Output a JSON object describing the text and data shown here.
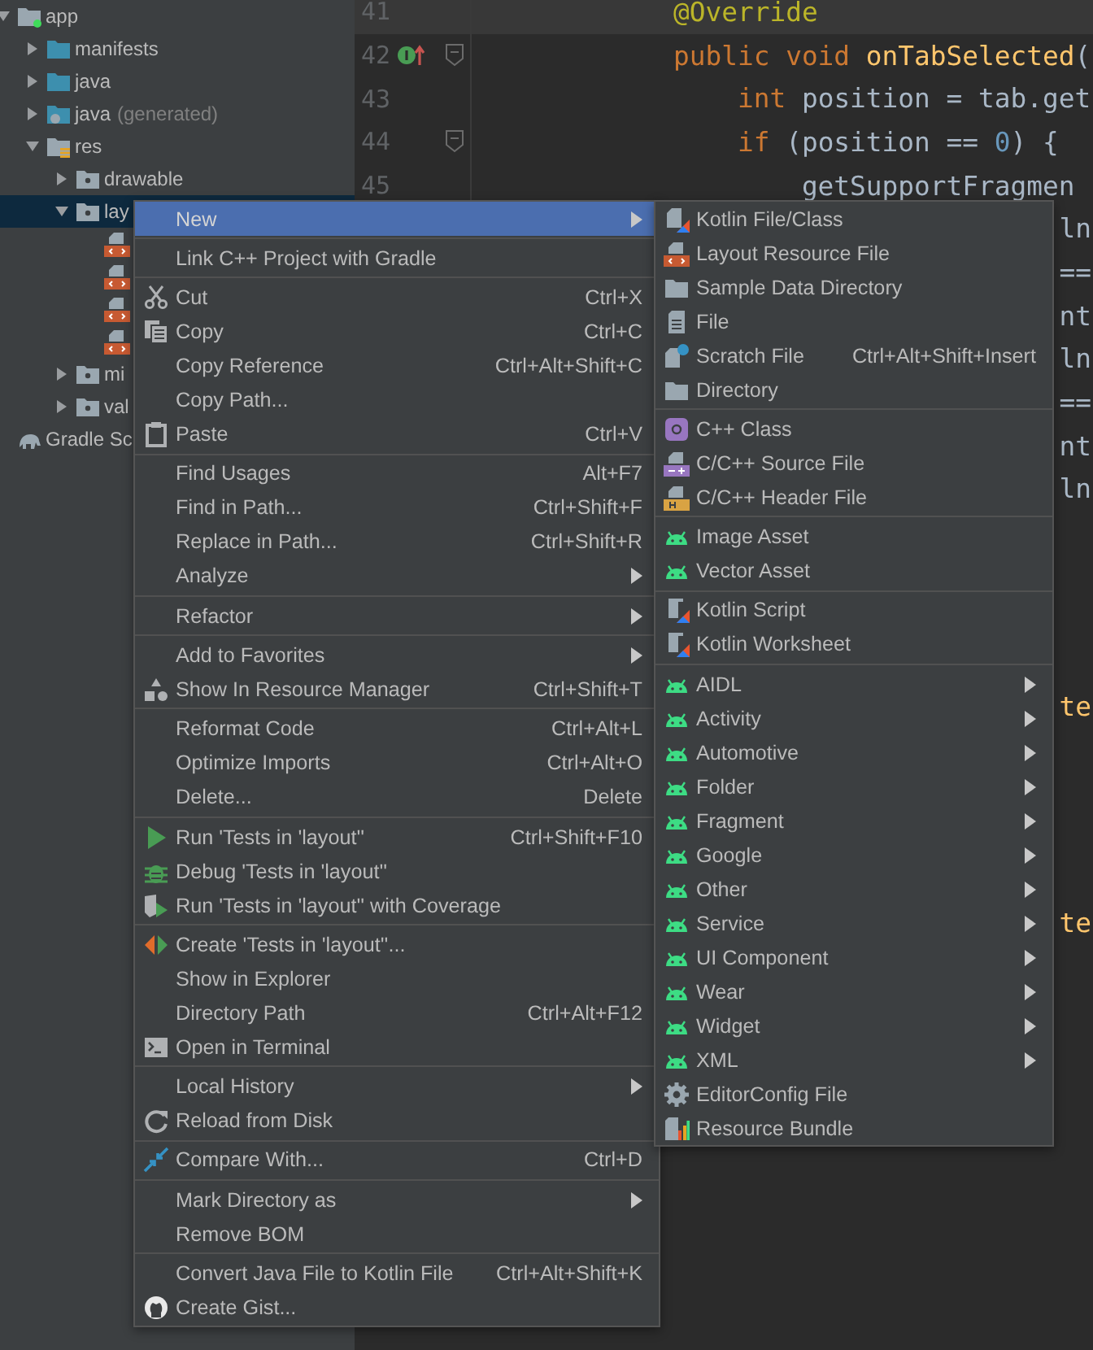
{
  "project_tree": [
    {
      "label": "app",
      "kind": "module",
      "expanded": true,
      "selected": false,
      "children": [
        {
          "label": "manifests",
          "kind": "folder",
          "expanded": false,
          "selected": false
        },
        {
          "label": "java",
          "kind": "folder",
          "expanded": false,
          "selected": false
        },
        {
          "label": "java",
          "note": "(generated)",
          "kind": "generated-folder",
          "expanded": false,
          "selected": false
        },
        {
          "label": "res",
          "kind": "res-folder",
          "expanded": true,
          "selected": false,
          "children": [
            {
              "label": "drawable",
              "kind": "res-dir",
              "expanded": false,
              "selected": false
            },
            {
              "label": "lay",
              "kind": "res-dir",
              "expanded": true,
              "selected": true,
              "children": [
                {
                  "kind": "layout-file",
                  "selected": false
                },
                {
                  "kind": "layout-file",
                  "selected": false
                },
                {
                  "kind": "layout-file",
                  "selected": false
                },
                {
                  "kind": "layout-file",
                  "selected": false
                }
              ]
            },
            {
              "label": "mi",
              "kind": "res-dir",
              "expanded": false,
              "selected": false
            },
            {
              "label": "val",
              "kind": "res-dir",
              "expanded": false,
              "selected": false
            }
          ]
        }
      ]
    },
    {
      "label": "Gradle Sc",
      "kind": "gradle",
      "selected": false
    }
  ],
  "editor": {
    "lines": [
      {
        "number": "41",
        "current": true,
        "fold": false,
        "marker": false,
        "tokens": [
          {
            "kind": "annotation",
            "text": "@Override"
          }
        ]
      },
      {
        "number": "42",
        "current": false,
        "fold": true,
        "marker": true,
        "tokens": [
          {
            "kind": "keyword",
            "text": "public void "
          },
          {
            "kind": "method",
            "text": "onTabSelected"
          },
          {
            "kind": "plain",
            "text": "("
          }
        ]
      },
      {
        "number": "43",
        "current": false,
        "fold": false,
        "marker": false,
        "tokens": [
          {
            "kind": "keyword",
            "text": "    int "
          },
          {
            "kind": "plain",
            "text": "position = tab.get"
          }
        ]
      },
      {
        "number": "44",
        "current": false,
        "fold": true,
        "marker": false,
        "tokens": [
          {
            "kind": "keyword",
            "text": "    if "
          },
          {
            "kind": "plain",
            "text": "(position == "
          },
          {
            "kind": "number",
            "text": "0"
          },
          {
            "kind": "plain",
            "text": ") {"
          }
        ]
      },
      {
        "number": "45",
        "current": false,
        "fold": false,
        "marker": false,
        "tokens": [
          {
            "kind": "plain",
            "text": "        getSupportFragmen"
          }
        ]
      }
    ],
    "fragments": [
      {
        "kind": "plain",
        "text": "ln"
      },
      {
        "kind": "plain",
        "text": "=="
      },
      {
        "kind": "plain",
        "text": "nt"
      },
      {
        "kind": "plain",
        "text": "ln"
      },
      {
        "kind": "plain",
        "text": "=="
      },
      {
        "kind": "plain",
        "text": "nt"
      },
      {
        "kind": "plain",
        "text": "ln"
      },
      {
        "kind": "method",
        "text": "te"
      },
      {
        "kind": "method",
        "text": "te"
      }
    ]
  },
  "context_menu": {
    "groups": [
      [
        {
          "label": "New",
          "submenu": true,
          "selected": true
        }
      ],
      [
        {
          "label": "Link C++ Project with Gradle",
          "submenu": false,
          "selected": false
        }
      ],
      [
        {
          "label": "Cut",
          "shortcut": "Ctrl+X",
          "submenu": false,
          "selected": false
        },
        {
          "label": "Copy",
          "shortcut": "Ctrl+C",
          "submenu": false,
          "selected": false
        },
        {
          "label": "Copy Reference",
          "shortcut": "Ctrl+Alt+Shift+C",
          "submenu": false,
          "selected": false
        },
        {
          "label": "Copy Path...",
          "submenu": false,
          "selected": false
        },
        {
          "label": "Paste",
          "shortcut": "Ctrl+V",
          "submenu": false,
          "selected": false
        }
      ],
      [
        {
          "label": "Find Usages",
          "shortcut": "Alt+F7",
          "submenu": false,
          "selected": false
        },
        {
          "label": "Find in Path...",
          "shortcut": "Ctrl+Shift+F",
          "submenu": false,
          "selected": false
        },
        {
          "label": "Replace in Path...",
          "shortcut": "Ctrl+Shift+R",
          "submenu": false,
          "selected": false
        },
        {
          "label": "Analyze",
          "submenu": true,
          "selected": false
        }
      ],
      [
        {
          "label": "Refactor",
          "submenu": true,
          "selected": false
        }
      ],
      [
        {
          "label": "Add to Favorites",
          "submenu": true,
          "selected": false
        },
        {
          "label": "Show In Resource Manager",
          "shortcut": "Ctrl+Shift+T",
          "submenu": false,
          "selected": false
        }
      ],
      [
        {
          "label": "Reformat Code",
          "shortcut": "Ctrl+Alt+L",
          "submenu": false,
          "selected": false
        },
        {
          "label": "Optimize Imports",
          "shortcut": "Ctrl+Alt+O",
          "submenu": false,
          "selected": false
        },
        {
          "label": "Delete...",
          "shortcut": "Delete",
          "submenu": false,
          "selected": false
        }
      ],
      [
        {
          "label": "Run 'Tests in 'layout''",
          "shortcut": "Ctrl+Shift+F10",
          "submenu": false,
          "selected": false
        },
        {
          "label": "Debug 'Tests in 'layout''",
          "submenu": false,
          "selected": false
        },
        {
          "label": "Run 'Tests in 'layout'' with Coverage",
          "submenu": false,
          "selected": false
        }
      ],
      [
        {
          "label": "Create 'Tests in 'layout''...",
          "submenu": false,
          "selected": false
        },
        {
          "label": "Show in Explorer",
          "submenu": false,
          "selected": false
        },
        {
          "label": "Directory Path",
          "shortcut": "Ctrl+Alt+F12",
          "submenu": false,
          "selected": false
        },
        {
          "label": "Open in Terminal",
          "submenu": false,
          "selected": false
        }
      ],
      [
        {
          "label": "Local History",
          "submenu": true,
          "selected": false
        },
        {
          "label": "Reload from Disk",
          "submenu": false,
          "selected": false
        }
      ],
      [
        {
          "label": "Compare With...",
          "shortcut": "Ctrl+D",
          "submenu": false,
          "selected": false
        }
      ],
      [
        {
          "label": "Mark Directory as",
          "submenu": true,
          "selected": false
        },
        {
          "label": "Remove BOM",
          "submenu": false,
          "selected": false
        }
      ],
      [
        {
          "label": "Convert Java File to Kotlin File",
          "shortcut": "Ctrl+Alt+Shift+K",
          "submenu": false,
          "selected": false
        },
        {
          "label": "Create Gist...",
          "submenu": false,
          "selected": false
        }
      ]
    ]
  },
  "new_submenu": {
    "groups": [
      [
        {
          "label": "Kotlin File/Class",
          "submenu": false,
          "selected": false
        },
        {
          "label": "Layout Resource File",
          "submenu": false,
          "selected": false
        },
        {
          "label": "Sample Data Directory",
          "submenu": false,
          "selected": false
        },
        {
          "label": "File",
          "submenu": false,
          "selected": false
        },
        {
          "label": "Scratch File",
          "shortcut": "Ctrl+Alt+Shift+Insert",
          "submenu": false,
          "selected": false
        },
        {
          "label": "Directory",
          "submenu": false,
          "selected": false
        }
      ],
      [
        {
          "label": "C++ Class",
          "submenu": false,
          "selected": false
        },
        {
          "label": "C/C++ Source File",
          "submenu": false,
          "selected": false
        },
        {
          "label": "C/C++ Header File",
          "submenu": false,
          "selected": false
        }
      ],
      [
        {
          "label": "Image Asset",
          "submenu": false,
          "selected": false
        },
        {
          "label": "Vector Asset",
          "submenu": false,
          "selected": false
        }
      ],
      [
        {
          "label": "Kotlin Script",
          "submenu": false,
          "selected": false
        },
        {
          "label": "Kotlin Worksheet",
          "submenu": false,
          "selected": false
        }
      ],
      [
        {
          "label": "AIDL",
          "submenu": true,
          "selected": false
        },
        {
          "label": "Activity",
          "submenu": true,
          "selected": false
        },
        {
          "label": "Automotive",
          "submenu": true,
          "selected": false
        },
        {
          "label": "Folder",
          "submenu": true,
          "selected": false
        },
        {
          "label": "Fragment",
          "submenu": true,
          "selected": false
        },
        {
          "label": "Google",
          "submenu": true,
          "selected": false
        },
        {
          "label": "Other",
          "submenu": true,
          "selected": false
        },
        {
          "label": "Service",
          "submenu": true,
          "selected": false
        },
        {
          "label": "UI Component",
          "submenu": true,
          "selected": false
        },
        {
          "label": "Wear",
          "submenu": true,
          "selected": false
        },
        {
          "label": "Widget",
          "submenu": true,
          "selected": false
        },
        {
          "label": "XML",
          "submenu": true,
          "selected": false
        },
        {
          "label": "EditorConfig File",
          "submenu": false,
          "selected": false
        },
        {
          "label": "Resource Bundle",
          "submenu": false,
          "selected": false
        }
      ]
    ]
  }
}
